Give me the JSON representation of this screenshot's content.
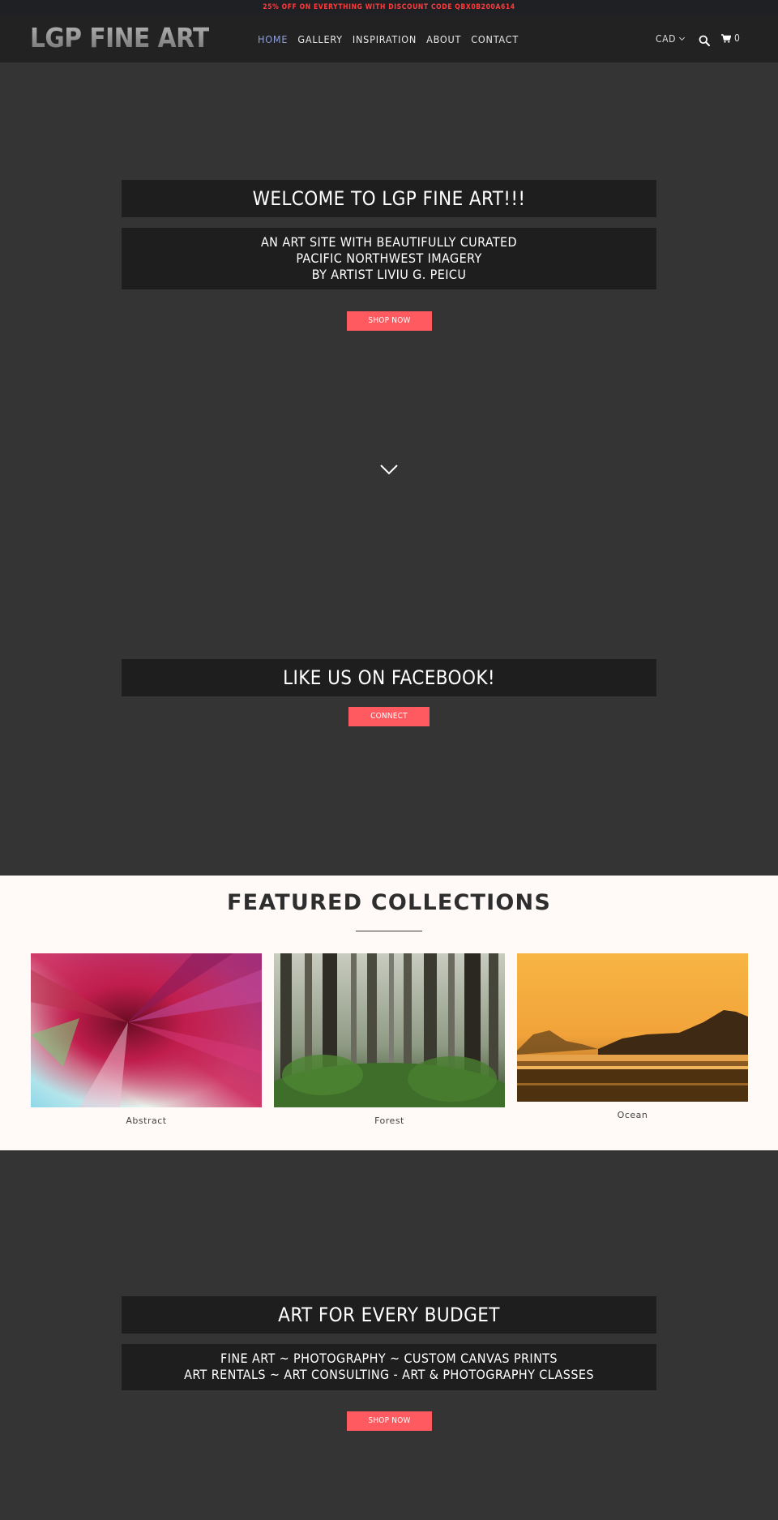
{
  "announcement": "25% OFF ON EVERYTHING WITH DISCOUNT CODE QBX0B200A614",
  "header": {
    "logo": "LGP FINE ART",
    "nav": [
      "HOME",
      "GALLERY",
      "INSPIRATION",
      "ABOUT",
      "CONTACT"
    ],
    "active_nav": "HOME",
    "currency": "CAD",
    "cart_count": "0",
    "icons": [
      "search-icon",
      "cart-icon",
      "chevron-down-icon"
    ]
  },
  "hero": {
    "title": "WELCOME TO LGP FINE ART!!!",
    "subtitle_lines": [
      "AN ART SITE WITH BEAUTIFULLY CURATED",
      "PACIFIC NORTHWEST IMAGERY",
      "BY ARTIST LIVIU G. PEICU"
    ],
    "button": "SHOP NOW"
  },
  "facebook": {
    "title": "LIKE US ON FACEBOOK!",
    "button": "CONNECT"
  },
  "featured": {
    "title": "FEATURED COLLECTIONS",
    "collections": [
      {
        "name": "Abstract"
      },
      {
        "name": "Forest"
      },
      {
        "name": "Ocean"
      }
    ]
  },
  "budget": {
    "title": "ART FOR EVERY BUDGET",
    "subtitle_lines": [
      "FINE ART ~ PHOTOGRAPHY ~ CUSTOM CANVAS PRINTS",
      "ART RENTALS ~ ART CONSULTING - ART & PHOTOGRAPHY CLASSES"
    ],
    "button": "SHOP NOW"
  },
  "colors": {
    "accent": "#ff5a5f",
    "announcement": "#ff3b3b",
    "active_nav": "#8ea0d8",
    "background": "#353435"
  }
}
